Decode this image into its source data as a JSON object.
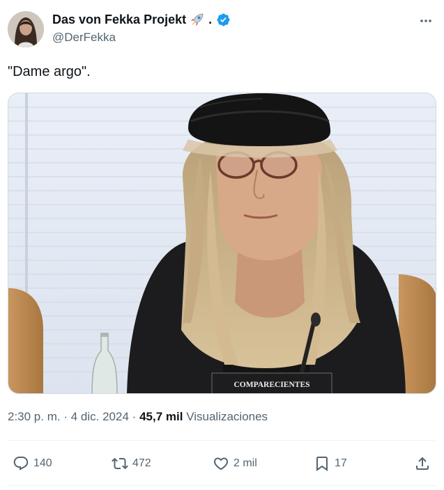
{
  "author": {
    "display_name": "Das von Fekka Projekt",
    "name_suffix": ".",
    "handle": "@DerFekka",
    "verified": true,
    "avatar_icon": "avatar-photo",
    "rocket_icon": "rocket-emoji"
  },
  "tweet": {
    "text": "\"Dame argo\".",
    "media_caption": "COMPARECIENTES"
  },
  "meta": {
    "time": "2:30 p. m.",
    "separator": "·",
    "date": "4 dic. 2024",
    "views_count": "45,7 mil",
    "views_label": "Visualizaciones"
  },
  "actions": {
    "replies": "140",
    "reposts": "472",
    "likes": "2 mil",
    "bookmarks": "17"
  },
  "colors": {
    "text_primary": "#0f1419",
    "text_secondary": "#536471",
    "verified_blue": "#1d9bf0",
    "divider": "#eff3f4"
  }
}
